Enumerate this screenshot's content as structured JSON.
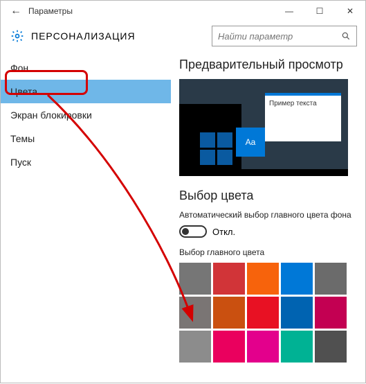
{
  "window": {
    "title": "Параметры",
    "back_glyph": "←",
    "min_glyph": "—",
    "max_glyph": "☐",
    "close_glyph": "✕"
  },
  "header": {
    "section": "ПЕРСОНАЛИЗАЦИЯ",
    "search_placeholder": "Найти параметр"
  },
  "sidebar": {
    "items": [
      {
        "label": "Фон"
      },
      {
        "label": "Цвета"
      },
      {
        "label": "Экран блокировки"
      },
      {
        "label": "Темы"
      },
      {
        "label": "Пуск"
      }
    ],
    "active_index": 1
  },
  "preview": {
    "heading": "Предварительный просмотр",
    "sample_text": "Пример текста",
    "aa": "Aa"
  },
  "color": {
    "heading": "Выбор цвета",
    "auto_label": "Автоматический выбор главного цвета фона",
    "toggle_state_label": "Откл.",
    "accent_label": "Выбор главного цвета",
    "swatches": [
      "#767676",
      "#d13438",
      "#f7630c",
      "#0078d7",
      "#6b6b6b",
      "#7a7574",
      "#ca5010",
      "#e81123",
      "#0063b1",
      "#c30052",
      "#8c8c8c",
      "#ea005e",
      "#e3008c",
      "#00b294",
      "#505050"
    ]
  }
}
